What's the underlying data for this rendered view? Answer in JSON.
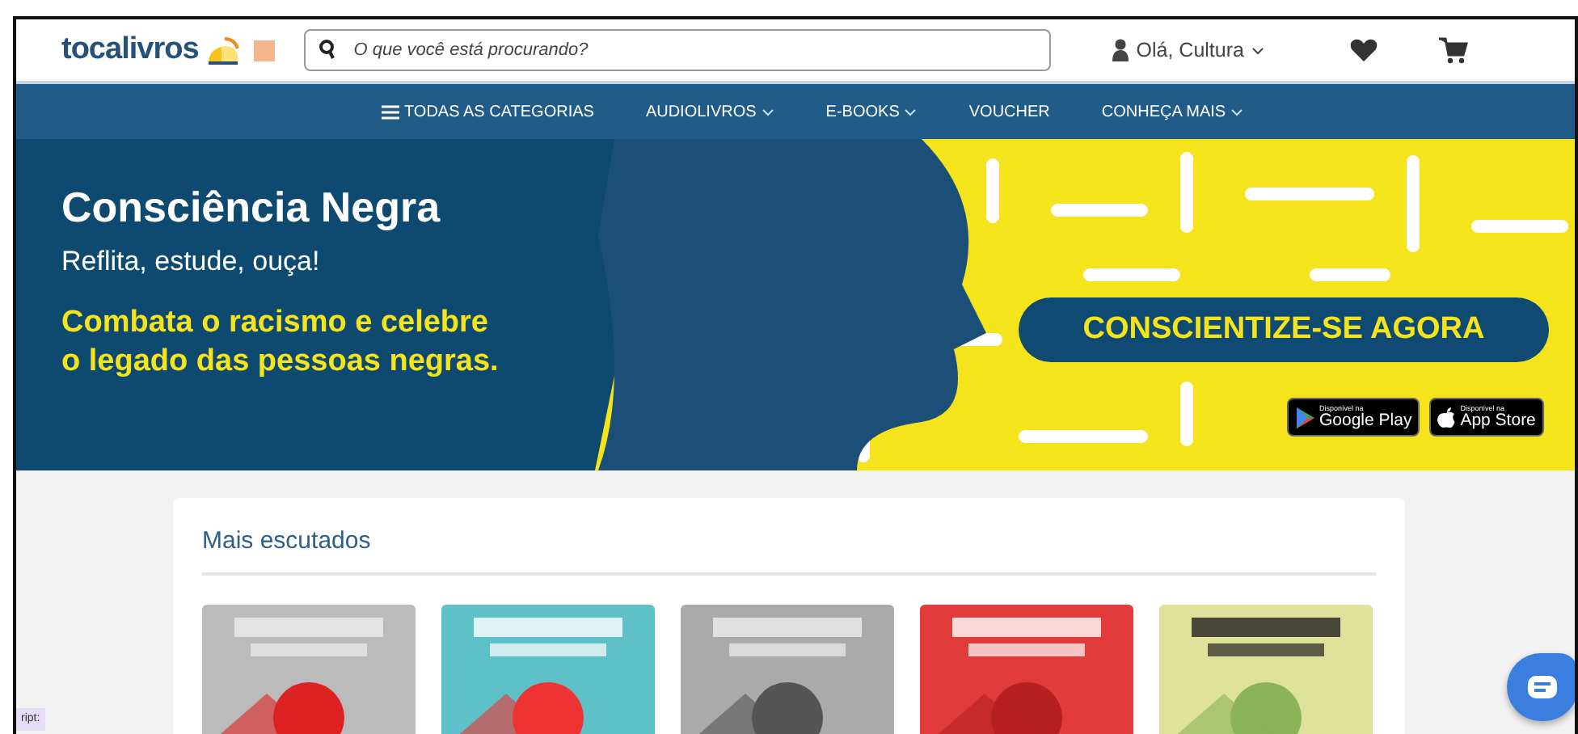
{
  "header": {
    "logo": "tocalivros",
    "search": {
      "placeholder": "O que você está procurando?"
    },
    "user": "Olá, Cultura"
  },
  "nav": [
    {
      "label": "TODAS AS CATEGORIAS",
      "kind": "menu"
    },
    {
      "label": "AUDIOLIVROS",
      "kind": "dropdown"
    },
    {
      "label": "E-BOOKS",
      "kind": "dropdown"
    },
    {
      "label": "VOUCHER",
      "kind": "plain"
    },
    {
      "label": "CONHEÇA MAIS",
      "kind": "dropdown"
    }
  ],
  "banner": {
    "title": "Consciência Negra",
    "subtitle": "Reflita, estude, ouça!",
    "lines": [
      "Combata o racismo e celebre",
      "o legado das pessoas negras."
    ],
    "cta": "CONSCIENTIZE-SE AGORA",
    "stores": [
      {
        "kind": "google",
        "caption": "Disponível na",
        "name": "Google Play"
      },
      {
        "kind": "apple",
        "caption": "Disponível na",
        "name": "App Store"
      }
    ]
  },
  "section": {
    "title": "Mais escutados"
  },
  "debug_tag": "ript:"
}
